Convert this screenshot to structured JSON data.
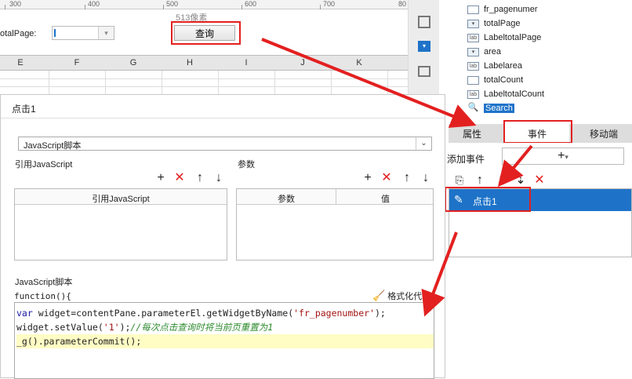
{
  "ruler": {
    "marks": [
      "300",
      "400",
      "500",
      "600",
      "700",
      "80"
    ]
  },
  "canvas": {
    "pixel_label": "513像素",
    "totalpage_label": "otalPage:",
    "query_button": "查询"
  },
  "grid": {
    "columns": [
      "E",
      "F",
      "G",
      "H",
      "I",
      "J",
      "K"
    ]
  },
  "tree": {
    "items": [
      {
        "icon": "textbox-icon",
        "label": "fr_pagenumer"
      },
      {
        "icon": "dropdown-icon",
        "label": "totalPage"
      },
      {
        "icon": "label-icon",
        "label": "LabeltotalPage"
      },
      {
        "icon": "dropdown-icon",
        "label": "area"
      },
      {
        "icon": "label-icon",
        "label": "Labelarea"
      },
      {
        "icon": "textbox-icon",
        "label": "totalCount"
      },
      {
        "icon": "label-icon",
        "label": "LabeltotalCount"
      },
      {
        "icon": "search-widget-icon",
        "label": "Search"
      }
    ]
  },
  "tabs": [
    {
      "label": "属性"
    },
    {
      "label": "事件"
    },
    {
      "label": "移动端"
    }
  ],
  "events": {
    "add_label": "添加事件",
    "items": [
      {
        "label": "点击1"
      }
    ]
  },
  "dialog": {
    "title": "点击1",
    "select_value": "JavaScript脚本",
    "ref_js_label": "引用JavaScript",
    "params_label": "参数",
    "ref_js_column": "引用JavaScript",
    "param_columns": [
      "参数",
      "值"
    ],
    "script_label": "JavaScript脚本",
    "function_label": "function(){",
    "format_button": "格式化代码",
    "code": [
      {
        "kw": "var",
        "text": " widget=contentPane.parameterEl.getWidgetByName(",
        "str": "'fr_pagenumber'",
        "end": ");",
        "comment": ""
      },
      {
        "kw": "",
        "text": "widget.setValue(",
        "str": "'1'",
        "end": ");",
        "comment": "//每次点击查询时将当前页重置为1"
      },
      {
        "kw": "",
        "text": "_g().parameterCommit();",
        "str": "",
        "end": "",
        "comment": ""
      }
    ]
  },
  "colors": {
    "accent": "#1e73c8",
    "annotation": "#e32020",
    "highlight": "#fffcc4"
  }
}
